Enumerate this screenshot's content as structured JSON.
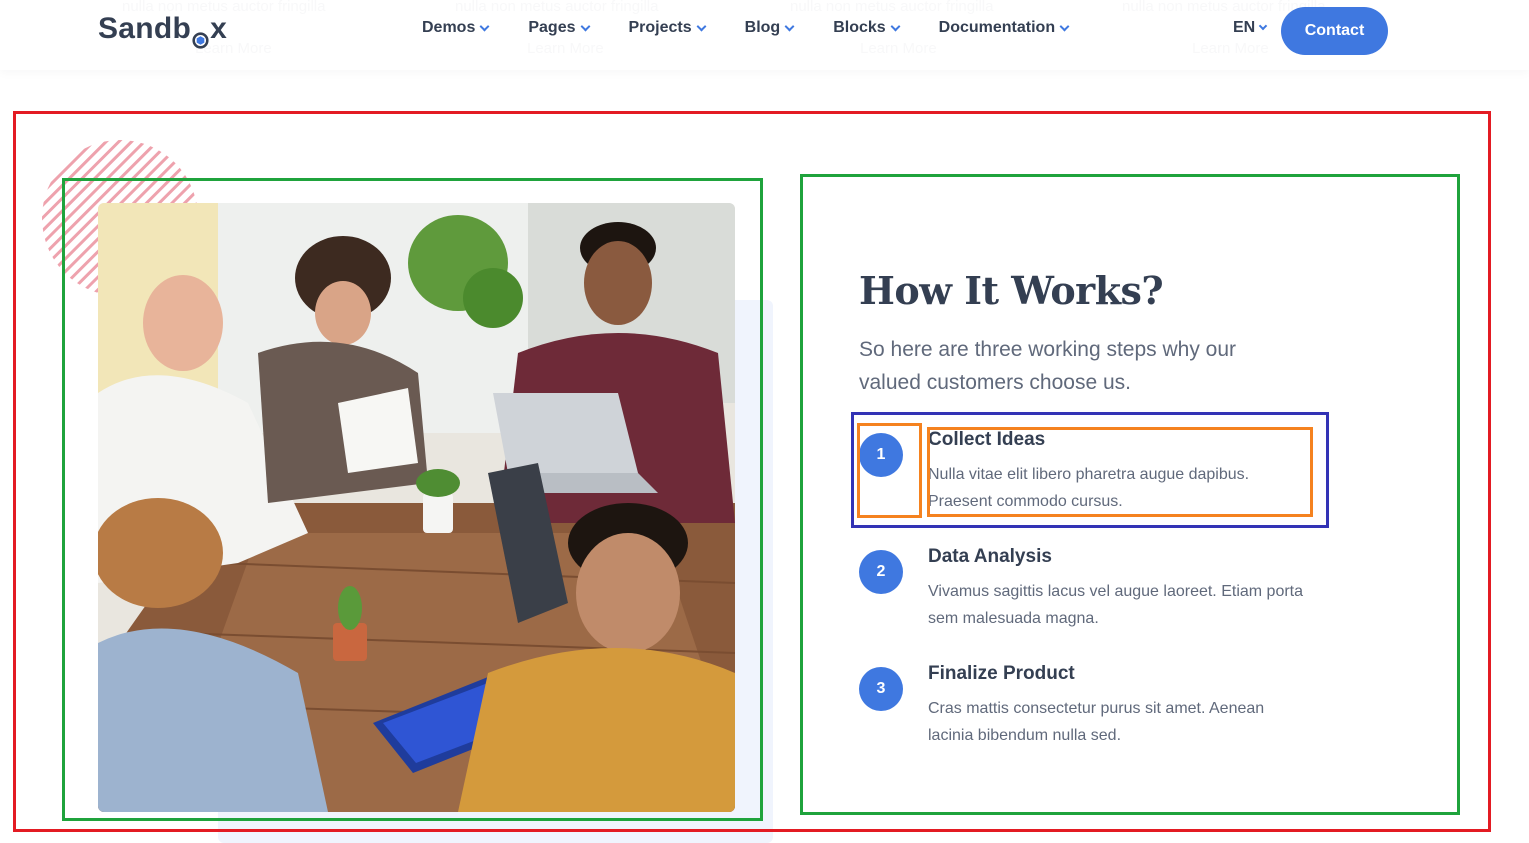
{
  "header": {
    "logo_text_left": "Sandb",
    "logo_text_right": "x",
    "nav": [
      {
        "label": "Demos"
      },
      {
        "label": "Pages"
      },
      {
        "label": "Projects"
      },
      {
        "label": "Blog"
      },
      {
        "label": "Blocks"
      },
      {
        "label": "Documentation"
      }
    ],
    "language": "EN",
    "contact_label": "Contact"
  },
  "section": {
    "title": "How It Works?",
    "lead": "So here are three working steps why our valued customers choose us.",
    "steps": [
      {
        "number": "1",
        "title": "Collect Ideas",
        "description": "Nulla vitae elit libero pharetra augue dapibus. Praesent commodo cursus."
      },
      {
        "number": "2",
        "title": "Data Analysis",
        "description": "Vivamus sagittis lacus vel augue laoreet. Etiam porta sem malesuada magna."
      },
      {
        "number": "3",
        "title": "Finalize Product",
        "description": "Cras mattis consectetur purus sit amet. Aenean lacinia bibendum nulla sed."
      }
    ]
  },
  "colors": {
    "primary": "#3f78e0",
    "heading": "#343f52",
    "body_text": "#60697b",
    "annotation_red": "#e31b23",
    "annotation_green": "#1fa33c",
    "annotation_blue": "#3333b5",
    "annotation_orange": "#f5821f"
  }
}
